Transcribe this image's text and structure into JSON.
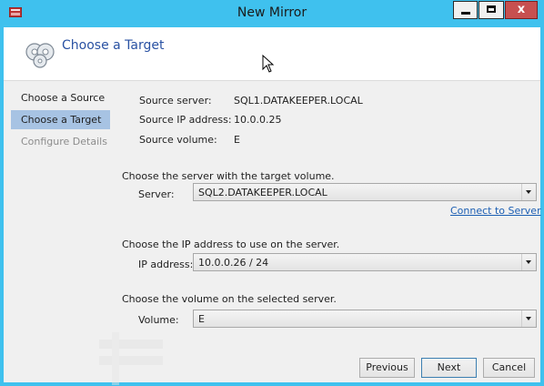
{
  "window": {
    "title": "New Mirror",
    "close_glyph": "x"
  },
  "header": {
    "title": "Choose a Target"
  },
  "nav": {
    "items": [
      {
        "label": "Choose a Source",
        "state": "normal"
      },
      {
        "label": "Choose a Target",
        "state": "active"
      },
      {
        "label": "Configure Details",
        "state": "disabled"
      }
    ]
  },
  "source": {
    "server_label": "Source server:",
    "server_value": "SQL1.DATAKEEPER.LOCAL",
    "ip_label": "Source IP address:",
    "ip_value": "10.0.0.25",
    "volume_label": "Source volume:",
    "volume_value": "E"
  },
  "target_server": {
    "prompt": "Choose the server with the target volume.",
    "label": "Server:",
    "value": "SQL2.DATAKEEPER.LOCAL",
    "connect_link": "Connect to Server"
  },
  "ip": {
    "prompt": "Choose the IP address to use on the server.",
    "label": "IP address:",
    "value": "10.0.0.26 / 24"
  },
  "volume": {
    "prompt": "Choose the volume on the selected server.",
    "label": "Volume:",
    "value": "E"
  },
  "buttons": {
    "previous": "Previous",
    "next": "Next",
    "cancel": "Cancel"
  },
  "colors": {
    "title_bar": "#3fc1ee",
    "accent_title": "#2a52a3",
    "nav_active": "#a7c3e3",
    "link": "#1c5fb3",
    "close_button": "#c75050"
  }
}
